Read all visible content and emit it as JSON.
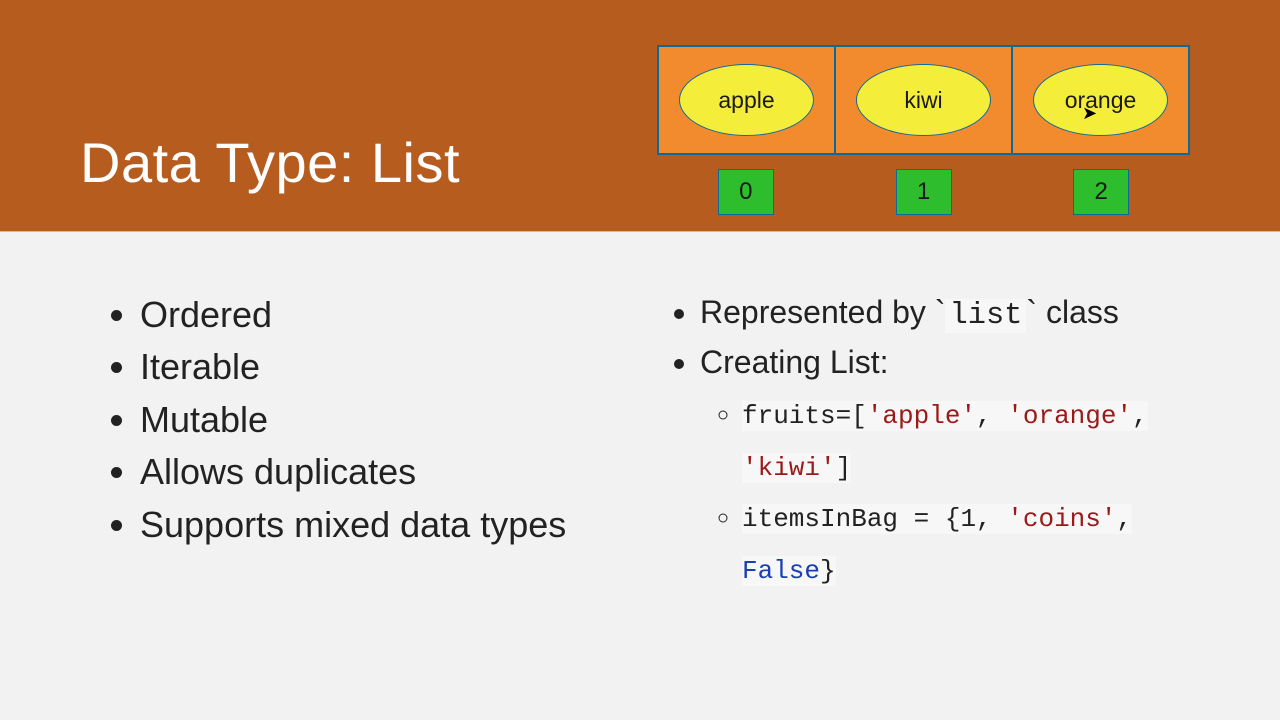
{
  "header": {
    "title": "Data Type: List"
  },
  "diagram": {
    "items": [
      "apple",
      "kiwi",
      "orange"
    ],
    "indices": [
      "0",
      "1",
      "2"
    ]
  },
  "left_bullets": [
    "Ordered",
    "Iterable",
    "Mutable",
    "Allows duplicates",
    "Supports mixed data types"
  ],
  "right": {
    "represented_prefix": "Represented by `",
    "represented_code": "list",
    "represented_suffix": "` class",
    "creating_label": "Creating List:",
    "ex1": {
      "p1": "fruits=[",
      "s1": "'apple'",
      "c1": ", ",
      "s2": "'orange'",
      "c2": ", ",
      "s3": "'kiwi'",
      "p2": "]"
    },
    "ex2": {
      "p1": "itemsInBag = {",
      "n1": "1",
      "c1": ", ",
      "s1": "'coins'",
      "c2": ", ",
      "k1": "False",
      "p2": "}"
    }
  }
}
